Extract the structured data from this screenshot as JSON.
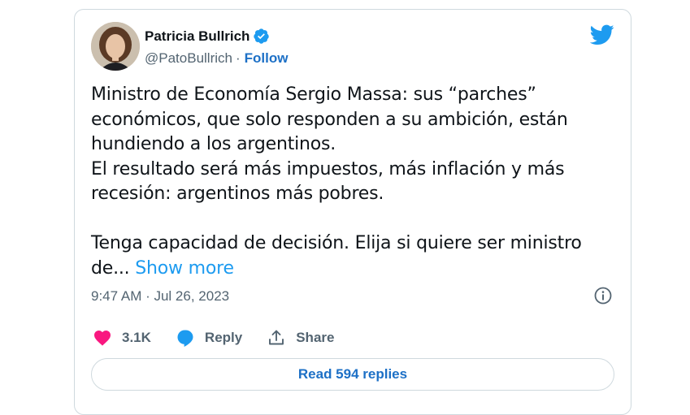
{
  "author": {
    "name": "Patricia Bullrich",
    "handle": "@PatoBullrich",
    "separator": "·",
    "follow_label": "Follow"
  },
  "tweet": {
    "lines": [
      "Ministro de Economía Sergio Massa: sus “parches”",
      "económicos, que solo responden a su ambición, están",
      "hundiendo a los argentinos.",
      "El resultado será más impuestos, más inflación y más",
      "recesión: argentinos más pobres.",
      "",
      "Tenga capacidad de decisión. Elija si quiere ser ministro"
    ],
    "last_line_prefix": "de...",
    "show_more_label": "Show more",
    "timestamp": "9:47 AM · Jul 26, 2023"
  },
  "actions": {
    "likes": "3.1K",
    "reply_label": "Reply",
    "share_label": "Share"
  },
  "read_replies_label": "Read 594 replies",
  "colors": {
    "like": "#f91880",
    "reply": "#1d9bf0",
    "twitter_blue": "#1d9bf0",
    "link": "#1d70c6"
  },
  "icons": [
    "avatar",
    "verified-badge-icon",
    "twitter-bird-icon",
    "info-icon",
    "heart-icon",
    "reply-bubble-icon",
    "share-icon"
  ]
}
